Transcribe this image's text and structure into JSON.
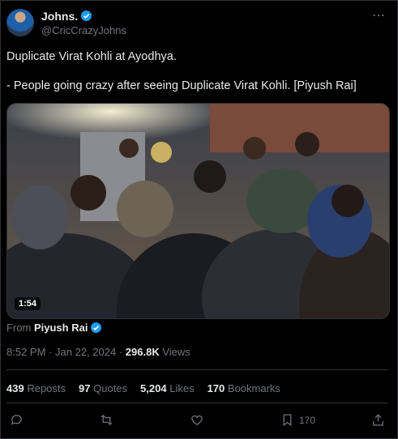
{
  "header": {
    "name": "Johns.",
    "handle": "@CricCrazyJohns",
    "more_icon": "more-icon"
  },
  "tweet": {
    "line1": "Duplicate Virat Kohli at Ayodhya.",
    "line2": "- People going crazy after seeing Duplicate Virat Kohli. [Piyush Rai]"
  },
  "media": {
    "duration": "1:54"
  },
  "source": {
    "prefix": "From",
    "name": "Piyush Rai"
  },
  "meta": {
    "time": "8:52 PM",
    "sep": "·",
    "date": "Jan 22, 2024",
    "views_count": "296.8K",
    "views_label": "Views"
  },
  "stats": {
    "reposts_count": "439",
    "reposts_label": "Reposts",
    "quotes_count": "97",
    "quotes_label": "Quotes",
    "likes_count": "5,204",
    "likes_label": "Likes",
    "bookmarks_count": "170",
    "bookmarks_label": "Bookmarks"
  },
  "actions": {
    "bookmark_count": "170"
  },
  "colors": {
    "background": "#000000",
    "text": "#e7e9ea",
    "muted": "#71767b",
    "verified": "#1d9bf0",
    "border": "#2f3336"
  }
}
